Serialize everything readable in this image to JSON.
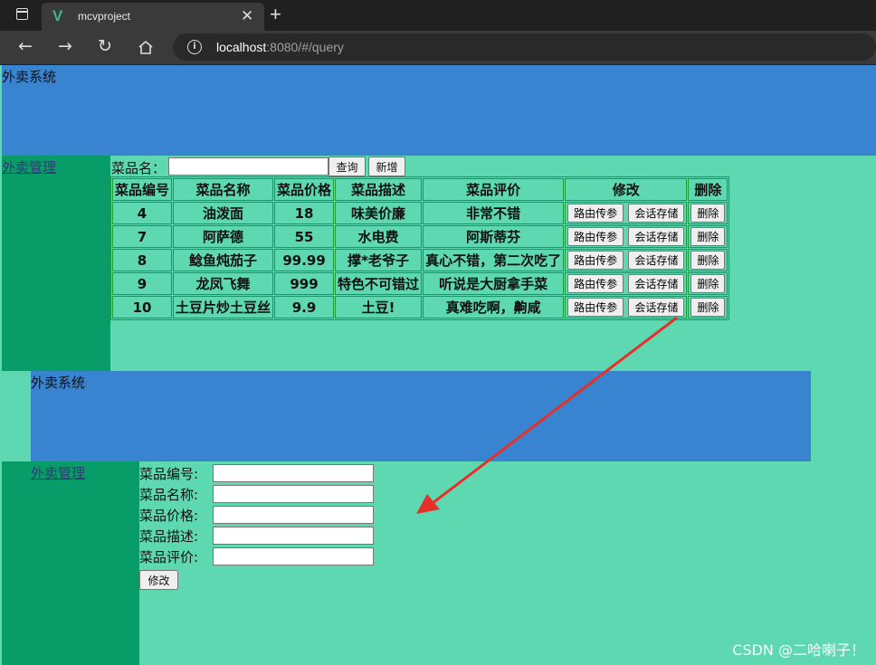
{
  "browser": {
    "tab_title": "mcvproject",
    "url_host": "localhost",
    "url_rest": ":8080/#/query",
    "new_tab_glyph": "+",
    "close_glyph": "✕"
  },
  "top_section": {
    "header_title": "外卖系统",
    "aside_link": "外卖管理",
    "search": {
      "label": "菜品名：",
      "value": "",
      "query_button": "查询",
      "add_button": "新增"
    },
    "table": {
      "headers": [
        "菜品编号",
        "菜品名称",
        "菜品价格",
        "菜品描述",
        "菜品评价",
        "修改",
        "删除"
      ],
      "rows": [
        {
          "id": "4",
          "name": "油泼面",
          "price": "18",
          "desc": "味美价廉",
          "review": "非常不错"
        },
        {
          "id": "7",
          "name": "阿萨德",
          "price": "55",
          "desc": "水电费",
          "review": "阿斯蒂芬"
        },
        {
          "id": "8",
          "name": "鲶鱼炖茄子",
          "price": "99.99",
          "desc": "撑*老爷子",
          "review": "真心不错，第二次吃了"
        },
        {
          "id": "9",
          "name": "龙凤飞舞",
          "price": "999",
          "desc": "特色不可错过",
          "review": "听说是大厨拿手菜"
        },
        {
          "id": "10",
          "name": "土豆片炒土豆丝",
          "price": "9.9",
          "desc": "土豆!",
          "review": "真难吃啊，齁咸"
        }
      ],
      "route_button": "路由传参",
      "session_button": "会话存储",
      "delete_button": "删除"
    }
  },
  "bottom_section": {
    "header_title": "外卖系统",
    "aside_link": "外卖管理",
    "form": {
      "id_label": "菜品编号:",
      "name_label": "菜品名称:",
      "price_label": "菜品价格:",
      "desc_label": "菜品描述:",
      "review_label": "菜品评价:",
      "submit_button": "修改"
    }
  },
  "watermark": "CSDN @二哈喇子！",
  "colors": {
    "header_blue": "#3884d0",
    "aside_green": "#079c68",
    "main_green": "#5dd8b1",
    "arrow_red": "#e8302a"
  }
}
